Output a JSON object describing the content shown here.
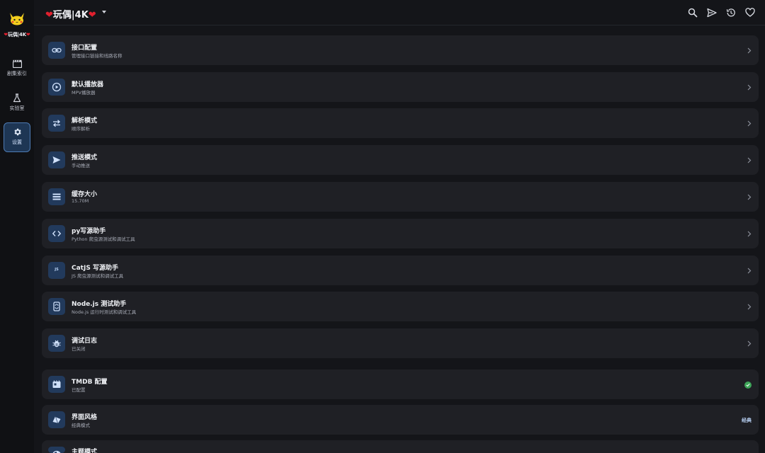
{
  "app": {
    "brand_short": "玩偶|4K",
    "title": "玩偶|4K"
  },
  "sidebar": {
    "items": [
      {
        "label": "剧集索引",
        "icon": "clapperboard-icon"
      },
      {
        "label": "实验室",
        "icon": "flask-icon"
      },
      {
        "label": "设置",
        "icon": "gear-icon",
        "active": true
      }
    ]
  },
  "header": {
    "icons": [
      "search-icon",
      "send-icon",
      "history-icon",
      "heart-icon"
    ]
  },
  "settings": {
    "items": [
      {
        "title": "接口配置",
        "subtitle": "管理接口链接和线路名称",
        "icon": "link-icon",
        "trailing": "chevron"
      },
      {
        "title": "默认播放器",
        "subtitle": "MPV播放器",
        "icon": "play-circle-icon",
        "trailing": "chevron"
      },
      {
        "title": "解析模式",
        "subtitle": "顺序解析",
        "icon": "swap-icon",
        "trailing": "chevron"
      },
      {
        "title": "推送模式",
        "subtitle": "手动推送",
        "icon": "send-icon",
        "trailing": "chevron"
      },
      {
        "title": "缓存大小",
        "subtitle": "15.70M",
        "icon": "storage-icon",
        "trailing": "chevron"
      },
      {
        "title": "py写源助手",
        "subtitle": "Python 爬虫源测试和调试工具",
        "icon": "code-icon",
        "trailing": "chevron"
      },
      {
        "title": "CatJS 写源助手",
        "subtitle": "JS 爬虫源测试和调试工具",
        "icon": "js-icon",
        "icon_text": "JS",
        "trailing": "chevron"
      },
      {
        "title": "Node.js 测试助手",
        "subtitle": "Node.js 运行时测试和调试工具",
        "icon": "phone-sync-icon",
        "trailing": "chevron"
      },
      {
        "title": "调试日志",
        "subtitle": "已关闭",
        "icon": "bug-icon",
        "trailing": "chevron"
      },
      {
        "title": "TMDB 配置",
        "subtitle": "已配置",
        "icon": "movie-icon",
        "trailing": "check"
      },
      {
        "title": "界面风格",
        "subtitle": "经典模式",
        "icon": "style-icon",
        "trailing": "badge",
        "badge": "经典"
      },
      {
        "title": "主题模式",
        "subtitle": "",
        "icon": "theme-icon",
        "trailing": "chevron"
      }
    ]
  },
  "colors": {
    "background": "#141519",
    "card": "#1f2025",
    "icon_bg": "#223a5c",
    "accent": "#4d7bb3",
    "heart": "#e0202e",
    "success": "#3ea559"
  }
}
